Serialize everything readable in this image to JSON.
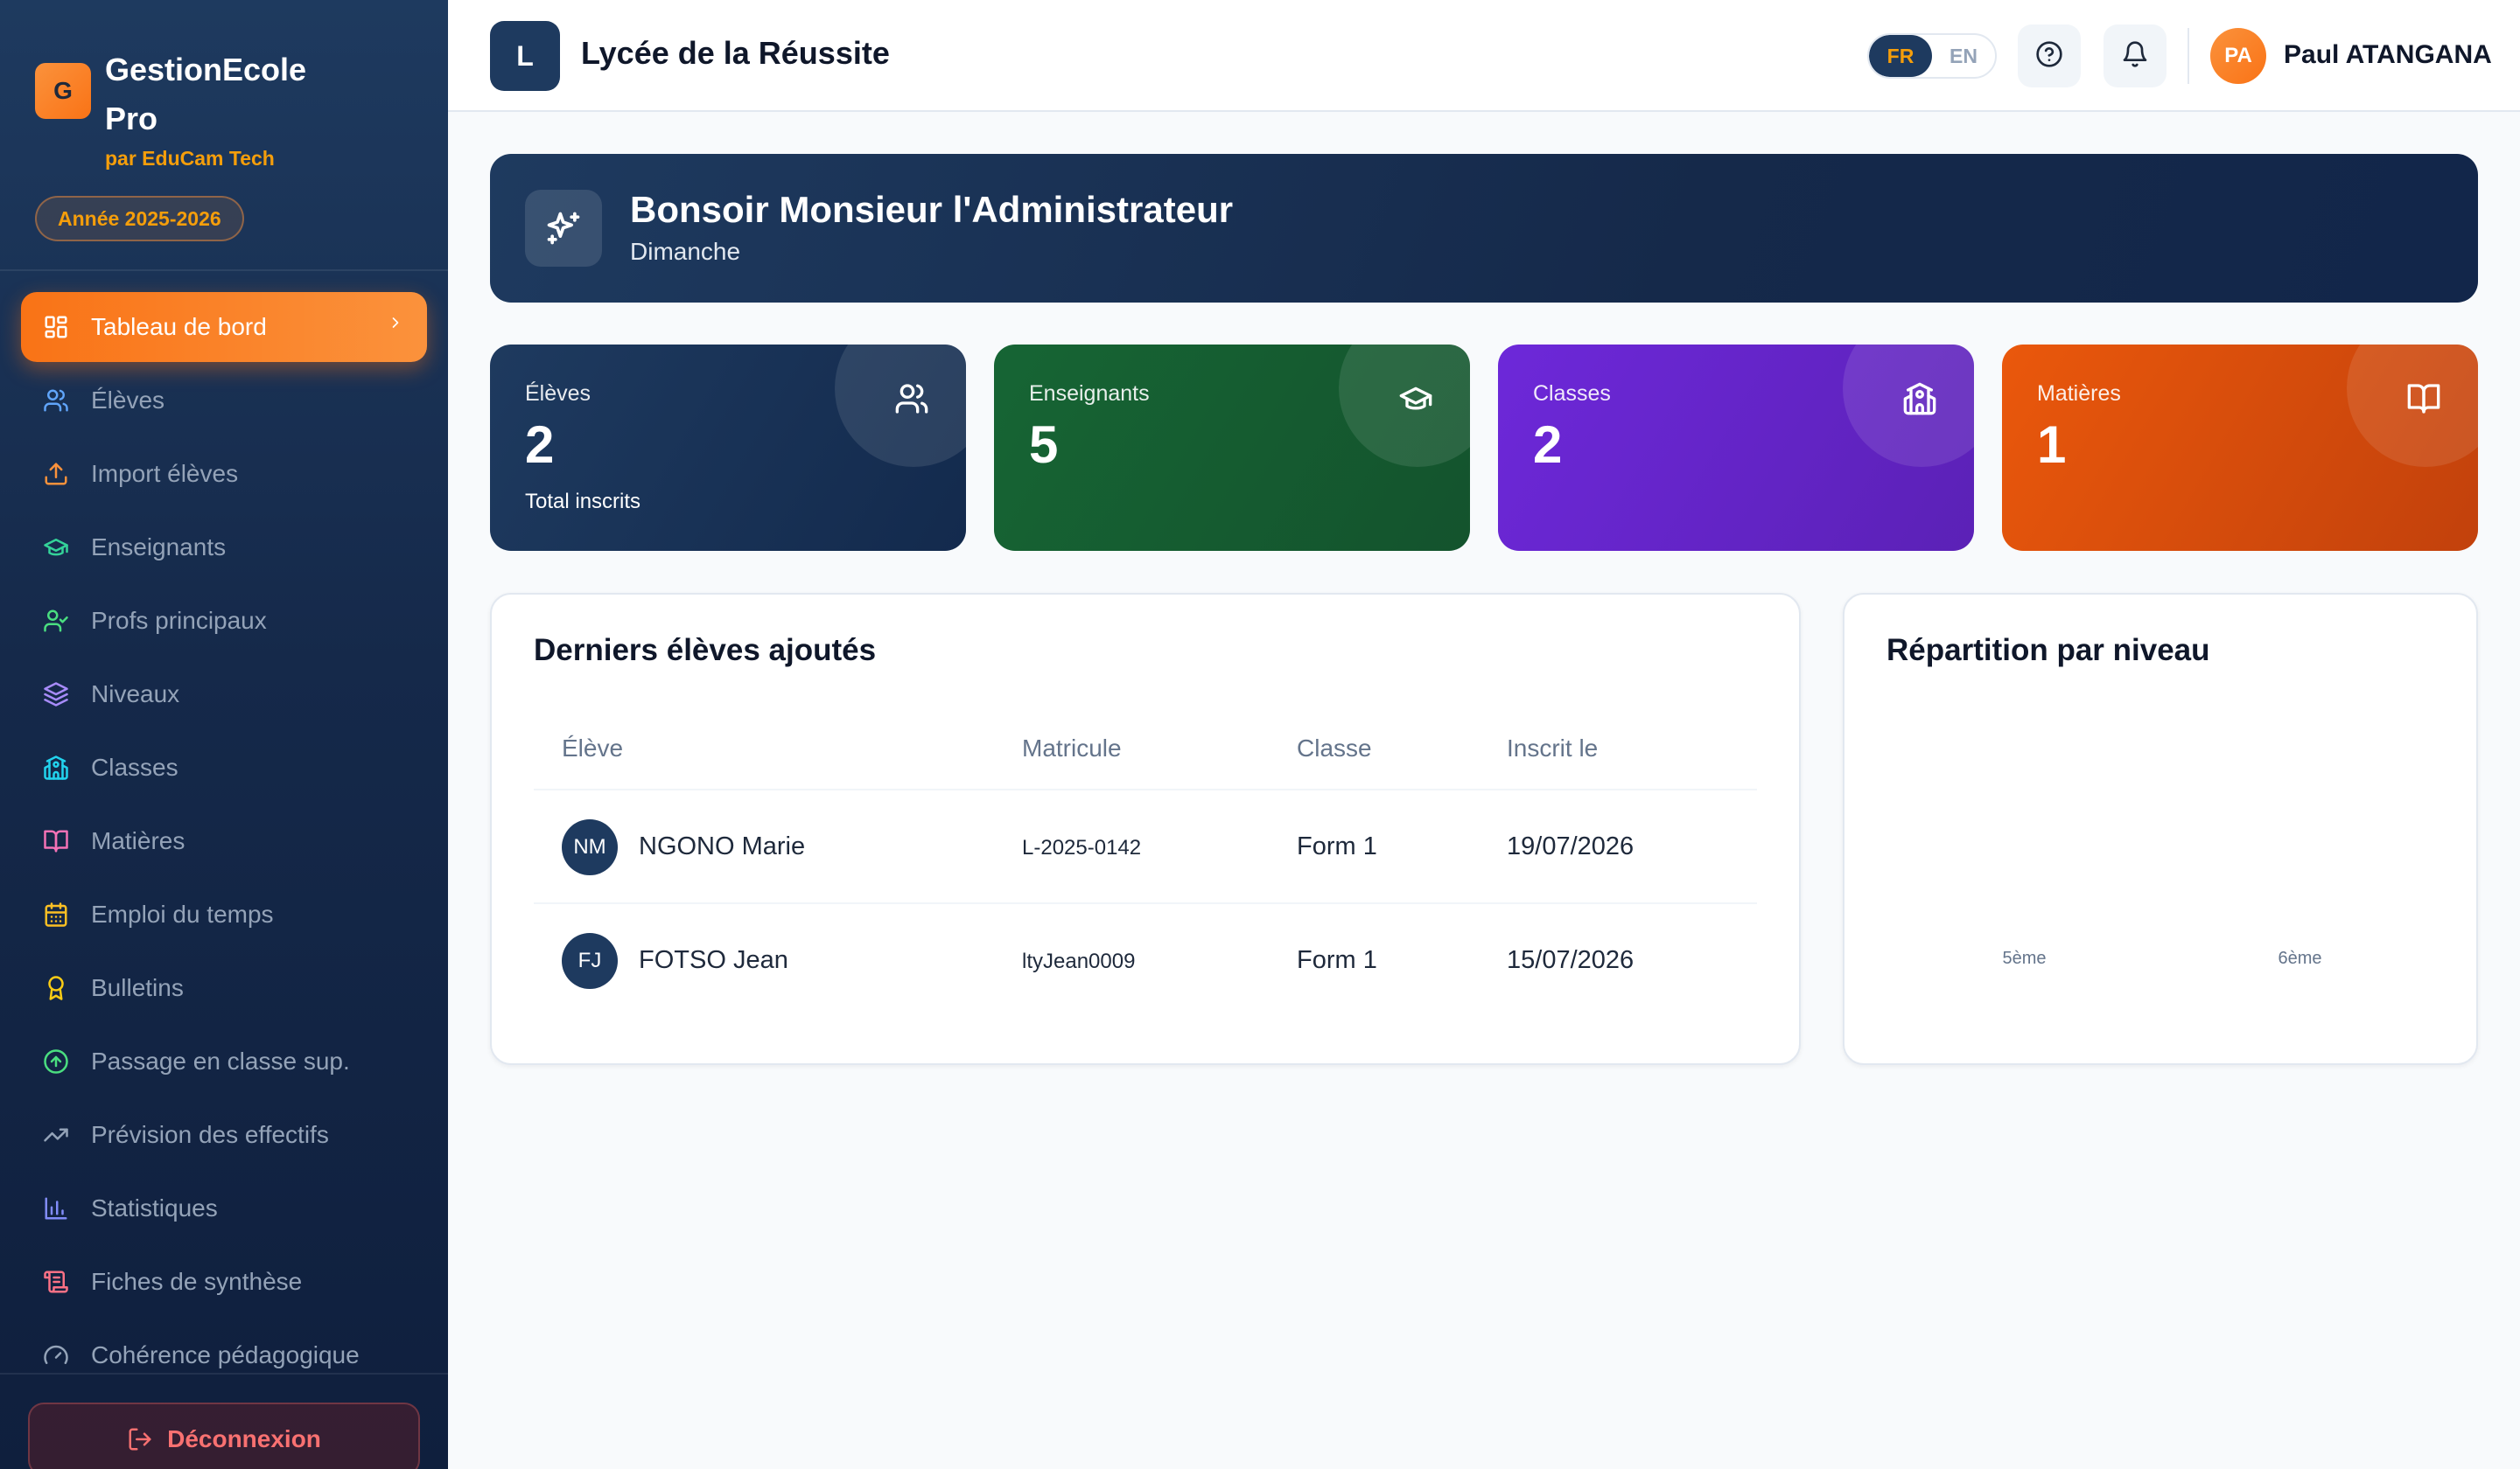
{
  "sidebar": {
    "brand_initial": "G",
    "brand_title": "GestionEcole Pro",
    "brand_subtitle": "par EduCam Tech",
    "year_badge": "Année 2025-2026",
    "nav": [
      {
        "label": "Tableau de bord",
        "icon": "dashboard-icon",
        "color": "#ffffff",
        "active": true
      },
      {
        "label": "Élèves",
        "icon": "users-icon",
        "color": "#60a5fa"
      },
      {
        "label": "Import élèves",
        "icon": "upload-icon",
        "color": "#fb923c"
      },
      {
        "label": "Enseignants",
        "icon": "graduation-cap-icon",
        "color": "#34d399"
      },
      {
        "label": "Profs principaux",
        "icon": "user-check-icon",
        "color": "#4ade80"
      },
      {
        "label": "Niveaux",
        "icon": "layers-icon",
        "color": "#a78bfa"
      },
      {
        "label": "Classes",
        "icon": "school-icon",
        "color": "#22d3ee"
      },
      {
        "label": "Matières",
        "icon": "book-icon",
        "color": "#f472b6"
      },
      {
        "label": "Emploi du temps",
        "icon": "calendar-icon",
        "color": "#fbbf24"
      },
      {
        "label": "Bulletins",
        "icon": "award-icon",
        "color": "#facc15"
      },
      {
        "label": "Passage en classe sup.",
        "icon": "arrow-up-circle-icon",
        "color": "#4ade80"
      },
      {
        "label": "Prévision des effectifs",
        "icon": "trending-up-icon",
        "color": "#94a3b8"
      },
      {
        "label": "Statistiques",
        "icon": "bar-chart-icon",
        "color": "#818cf8"
      },
      {
        "label": "Fiches de synthèse",
        "icon": "scroll-icon",
        "color": "#fb7185"
      },
      {
        "label": "Cohérence pédagogique",
        "icon": "gauge-icon",
        "color": "#94a3b8"
      }
    ],
    "logout_label": "Déconnexion"
  },
  "header": {
    "school_initial": "L",
    "school_name": "Lycée de la Réussite",
    "lang_fr": "FR",
    "lang_en": "EN",
    "active_lang": "FR",
    "user_initials": "PA",
    "user_name": "Paul ATANGANA"
  },
  "welcome": {
    "title": "Bonsoir Monsieur l'Administrateur",
    "subtitle": "Dimanche"
  },
  "stats": [
    {
      "label": "Élèves",
      "value": "2",
      "note": "Total inscrits",
      "icon": "users-icon",
      "color_from": "#1e3a5f",
      "color_to": "#132a4d"
    },
    {
      "label": "Enseignants",
      "value": "5",
      "note": "",
      "icon": "graduation-cap-icon",
      "color_from": "#166534",
      "color_to": "#14532d"
    },
    {
      "label": "Classes",
      "value": "2",
      "note": "",
      "icon": "school-icon",
      "color_from": "#6d28d9",
      "color_to": "#5b21b6"
    },
    {
      "label": "Matières",
      "value": "1",
      "note": "",
      "icon": "book-open-icon",
      "color_from": "#ea580c",
      "color_to": "#c2410c"
    }
  ],
  "recent_students": {
    "title": "Derniers élèves ajoutés",
    "columns": [
      "Élève",
      "Matricule",
      "Classe",
      "Inscrit le"
    ],
    "rows": [
      {
        "initials": "NM",
        "name": "NGONO Marie",
        "matricule": "L-2025-0142",
        "classe": "Form 1",
        "date": "19/07/2026"
      },
      {
        "initials": "FJ",
        "name": "FOTSO Jean",
        "matricule": "ltyJean0009",
        "classe": "Form 1",
        "date": "15/07/2026"
      }
    ]
  },
  "chart_data": {
    "type": "bar",
    "title": "Répartition par niveau",
    "categories": [
      "5ème",
      "6ème"
    ],
    "values": [
      0,
      0
    ],
    "xlabel": "",
    "ylabel": ""
  }
}
